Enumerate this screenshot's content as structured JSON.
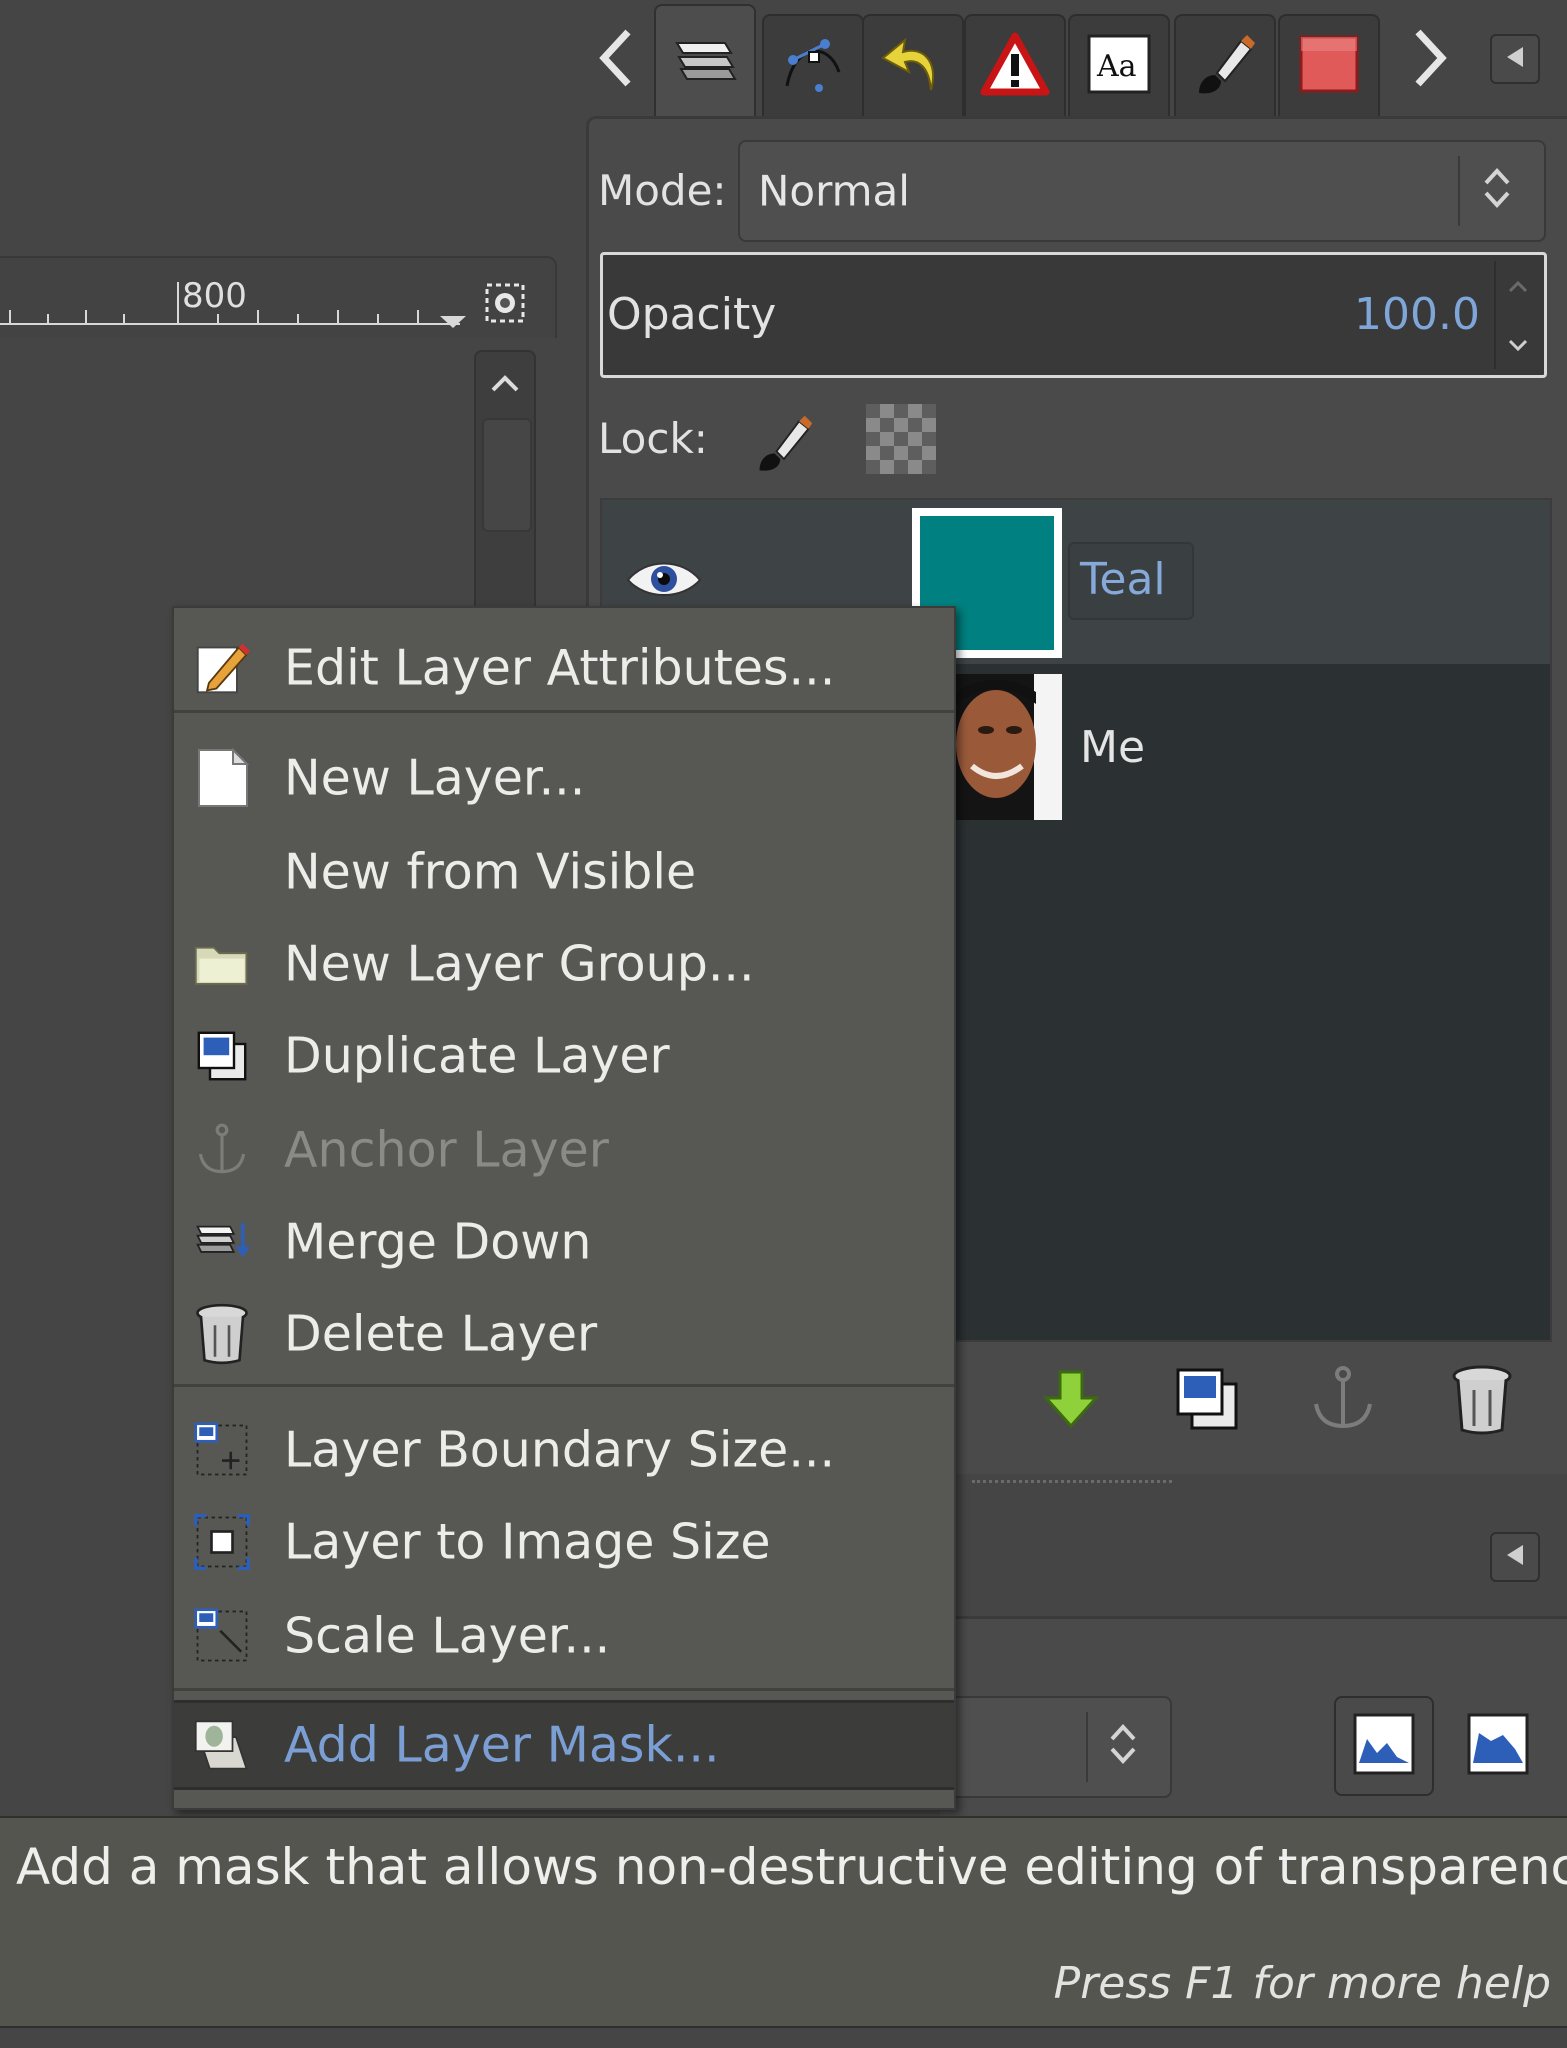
{
  "tabs": [
    {
      "name": "layers-icon"
    },
    {
      "name": "paths-icon"
    },
    {
      "name": "undo-history-icon"
    },
    {
      "name": "error-console-icon"
    },
    {
      "name": "fonts-icon"
    },
    {
      "name": "brushes-icon"
    },
    {
      "name": "patterns-icon"
    }
  ],
  "ruler": {
    "tick_label": "800"
  },
  "layers_panel": {
    "mode_label": "Mode:",
    "mode_value": "Normal",
    "opacity_label": "Opacity",
    "opacity_value": "100.0",
    "lock_label": "Lock:",
    "layers": [
      {
        "name": "Teal",
        "thumb_color": "#008080",
        "selected": true
      },
      {
        "name": "Me",
        "selected": false
      }
    ]
  },
  "context_menu": {
    "items": [
      {
        "label": "Edit Layer Attributes...",
        "enabled": true
      },
      {
        "label": "New Layer...",
        "enabled": true
      },
      {
        "label": "New from Visible",
        "enabled": true
      },
      {
        "label": "New Layer Group...",
        "enabled": true
      },
      {
        "label": "Duplicate Layer",
        "enabled": true
      },
      {
        "label": "Anchor Layer",
        "enabled": false
      },
      {
        "label": "Merge Down",
        "enabled": true
      },
      {
        "label": "Delete Layer",
        "enabled": true
      },
      {
        "label": "Layer Boundary Size...",
        "enabled": true
      },
      {
        "label": "Layer to Image Size",
        "enabled": true
      },
      {
        "label": "Scale Layer...",
        "enabled": true
      },
      {
        "label": "Add Layer Mask...",
        "enabled": true,
        "highlighted": true
      }
    ]
  },
  "tooltip": {
    "text": "Add a mask that allows non-destructive editing of transparency",
    "help": "Press F1 for more help"
  },
  "colors": {
    "teal": "#008080",
    "highlight_text": "#7b9fd4",
    "panel_bg": "#4a4a4a",
    "menu_bg": "#575853"
  }
}
